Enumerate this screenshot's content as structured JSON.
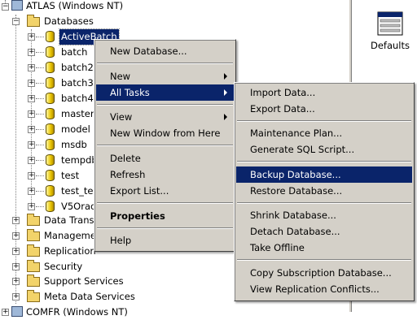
{
  "tree": {
    "server": "ATLAS (Windows NT)",
    "databases_label": "Databases",
    "databases": [
      "ActiveBatch",
      "batch",
      "batch2",
      "batch3",
      "batch4",
      "master",
      "model",
      "msdb",
      "tempdb",
      "test",
      "test_te",
      "V5Orac"
    ],
    "folders": [
      "Data Trans",
      "Manageme",
      "Replication",
      "Security",
      "Support Services",
      "Meta Data Services"
    ],
    "next_server": "COMFR (Windows NT)"
  },
  "right_pane": {
    "defaults_label": "Defaults"
  },
  "context_menu": {
    "items": [
      "New Database...",
      "New",
      "All Tasks",
      "View",
      "New Window from Here",
      "Delete",
      "Refresh",
      "Export List...",
      "Properties",
      "Help"
    ]
  },
  "submenu": {
    "items": [
      "Import Data...",
      "Export Data...",
      "Maintenance Plan...",
      "Generate SQL Script...",
      "Backup Database...",
      "Restore Database...",
      "Shrink Database...",
      "Detach Database...",
      "Take Offline",
      "Copy Subscription Database...",
      "View Replication Conflicts..."
    ]
  }
}
